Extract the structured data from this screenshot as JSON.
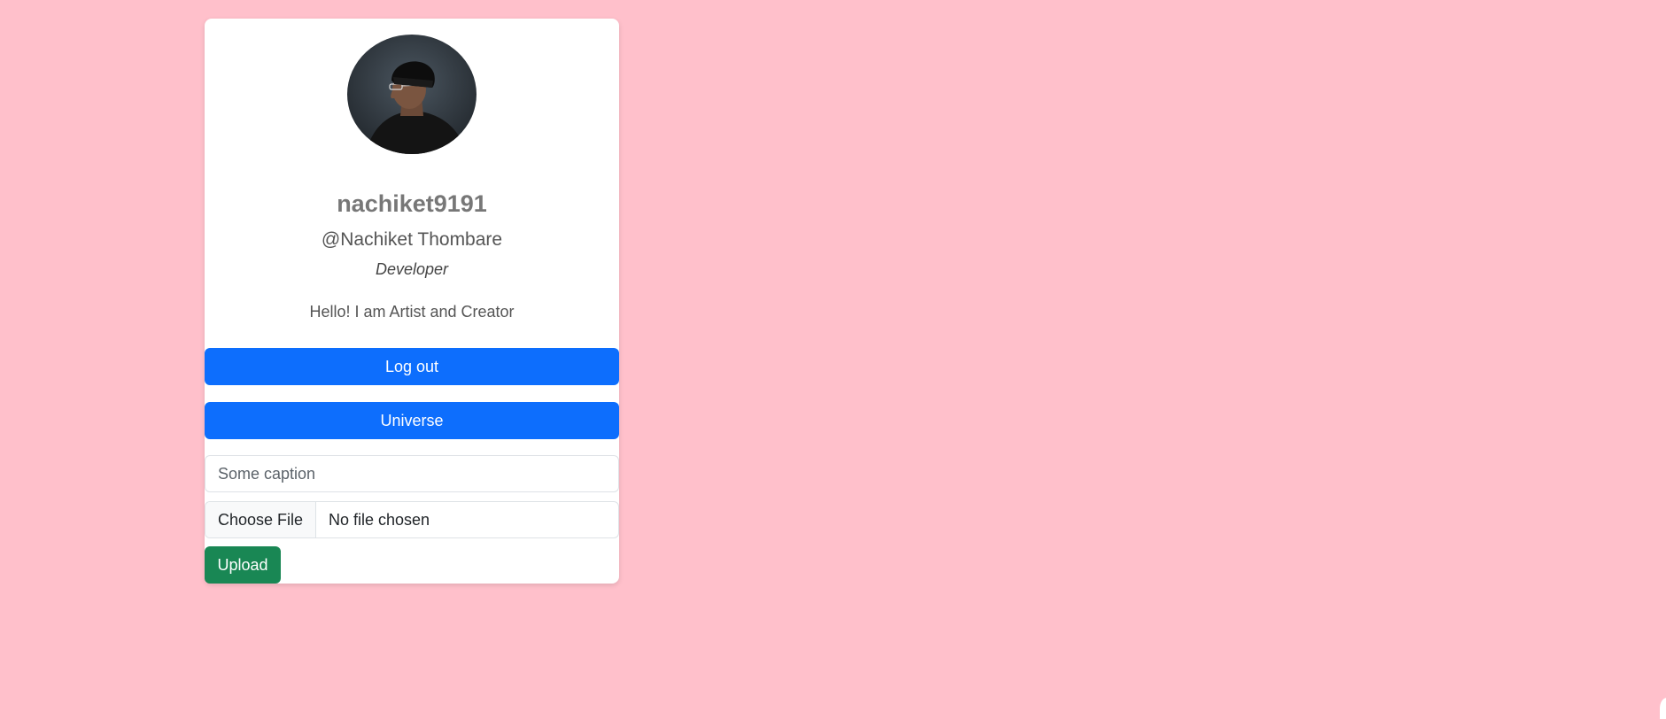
{
  "profile": {
    "avatar_alt": "avatar",
    "username": "nachiket9191",
    "full_name": "@Nachiket Thombare",
    "role": "Developer",
    "bio": "Hello! I am Artist and Creator"
  },
  "actions": {
    "logout_label": "Log out",
    "universe_label": "Universe"
  },
  "upload_form": {
    "caption_placeholder": "Some caption",
    "caption_value": "",
    "file_button_label": "Choose File",
    "file_status": "No file chosen",
    "upload_label": "Upload"
  },
  "colors": {
    "page_background": "#ffc0cb",
    "primary": "#0d6efd",
    "success": "#198754"
  },
  "icons": {
    "avatar": "profile-photo"
  }
}
